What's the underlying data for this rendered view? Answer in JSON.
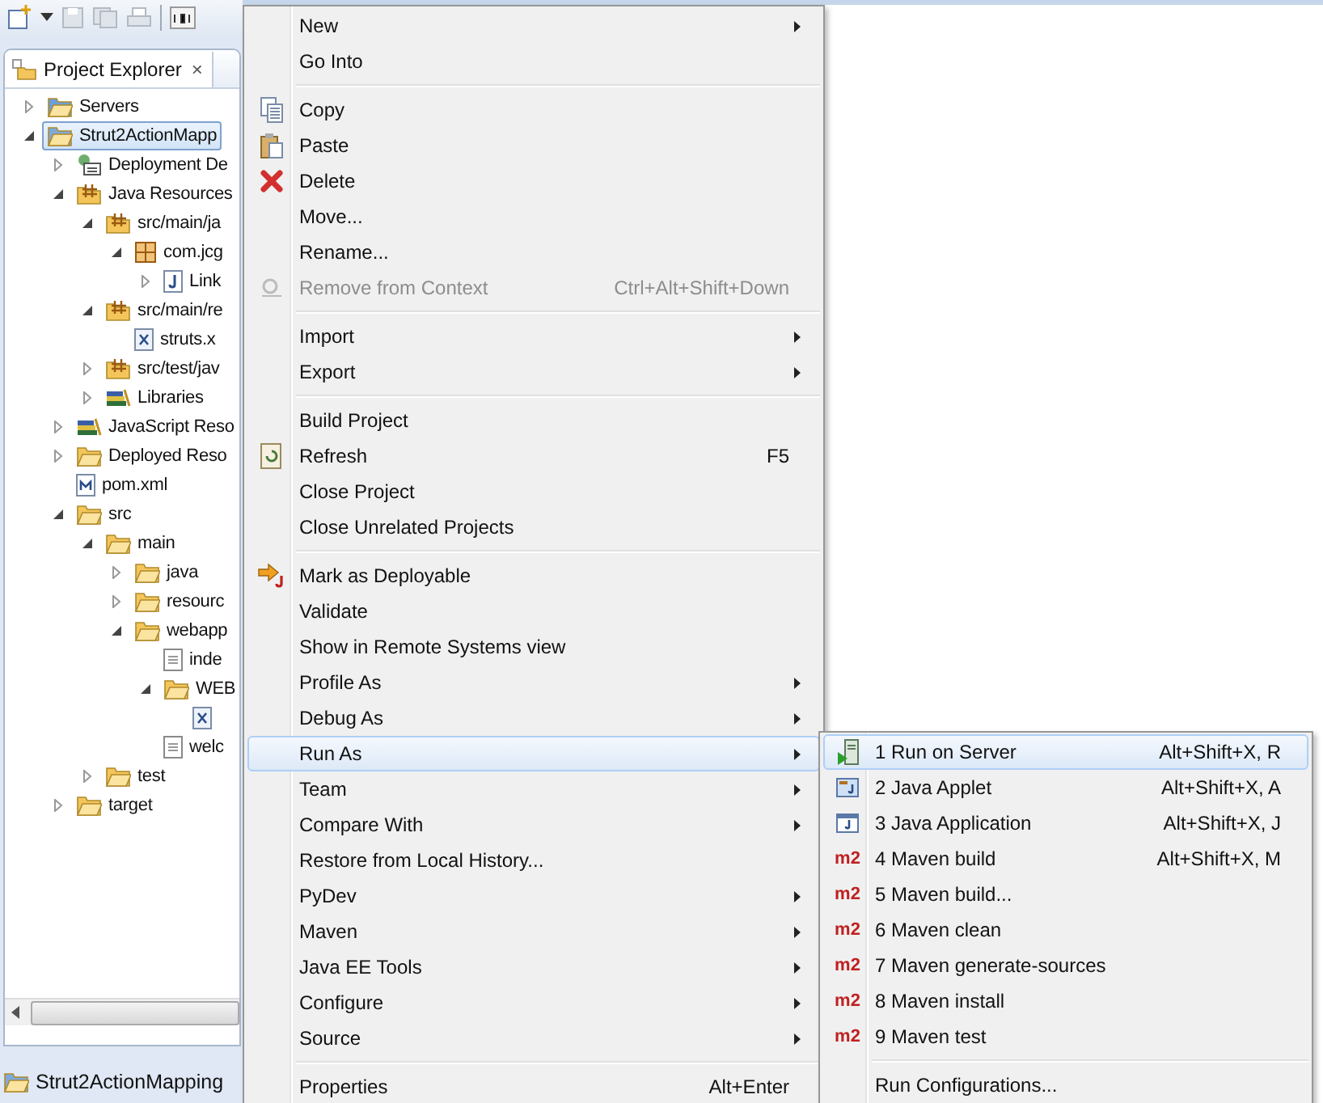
{
  "view": {
    "tab_label": "Project Explorer",
    "close_label": "×"
  },
  "tree": [
    {
      "label": "Servers",
      "kind": "servers",
      "selected": false,
      "expanded": false
    },
    {
      "label": "Strut2ActionMapp",
      "kind": "project",
      "selected": true,
      "expanded": true,
      "children": [
        {
          "label": "Deployment De",
          "kind": "descriptor",
          "selected": false,
          "expanded": false
        },
        {
          "label": "Java Resources",
          "kind": "javares",
          "selected": false,
          "expanded": true,
          "children": [
            {
              "label": "src/main/ja",
              "kind": "srcfolder",
              "selected": false,
              "expanded": true,
              "children": [
                {
                  "label": "com.jcg",
                  "kind": "package",
                  "selected": false,
                  "expanded": true,
                  "children": [
                    {
                      "label": "Link",
                      "kind": "javafile",
                      "selected": false,
                      "expanded": false
                    }
                  ]
                }
              ]
            },
            {
              "label": "src/main/re",
              "kind": "srcfolder",
              "selected": false,
              "expanded": true,
              "children": [
                {
                  "label": "struts.x",
                  "kind": "xmlfile",
                  "selected": false
                }
              ]
            },
            {
              "label": "src/test/jav",
              "kind": "srcfolder",
              "selected": false,
              "expanded": false
            },
            {
              "label": "Libraries",
              "kind": "libraries",
              "selected": false,
              "expanded": false
            }
          ]
        },
        {
          "label": "JavaScript Reso",
          "kind": "jsres",
          "selected": false,
          "expanded": false
        },
        {
          "label": "Deployed Reso",
          "kind": "deployed",
          "selected": false,
          "expanded": false
        },
        {
          "label": "pom.xml",
          "kind": "pom",
          "selected": false
        },
        {
          "label": "src",
          "kind": "folder",
          "selected": false,
          "expanded": true,
          "children": [
            {
              "label": "main",
              "kind": "folder",
              "selected": false,
              "expanded": true,
              "children": [
                {
                  "label": "java",
                  "kind": "folder",
                  "selected": false,
                  "expanded": false
                },
                {
                  "label": "resourc",
                  "kind": "folder",
                  "selected": false,
                  "expanded": false
                },
                {
                  "label": "webapp",
                  "kind": "folder",
                  "selected": false,
                  "expanded": true,
                  "children": [
                    {
                      "label": "inde",
                      "kind": "file",
                      "selected": false
                    },
                    {
                      "label": "WEB",
                      "kind": "folder",
                      "selected": false,
                      "expanded": true,
                      "children": [
                        {
                          "kind": "xmlfile",
                          "selected": false
                        }
                      ]
                    },
                    {
                      "label": "welc",
                      "kind": "file",
                      "selected": false
                    }
                  ]
                }
              ]
            },
            {
              "label": "test",
              "kind": "folder",
              "selected": false,
              "expanded": false
            }
          ]
        },
        {
          "label": "target",
          "kind": "folder",
          "selected": false,
          "expanded": false
        }
      ]
    }
  ],
  "status_bar": {
    "label": "Strut2ActionMapping"
  },
  "context_menu": {
    "groups": [
      [
        {
          "label": "New",
          "kind": "plain",
          "has_submenu": true,
          "disabled": false,
          "selected": false
        },
        {
          "label": "Go Into",
          "kind": "plain",
          "has_submenu": false,
          "disabled": false,
          "selected": false
        }
      ],
      [
        {
          "label": "Copy",
          "kind": "copy",
          "has_submenu": false,
          "disabled": false,
          "selected": false
        },
        {
          "label": "Paste",
          "kind": "paste",
          "has_submenu": false,
          "disabled": false,
          "selected": false
        },
        {
          "label": "Delete",
          "kind": "delete",
          "has_submenu": false,
          "disabled": false,
          "selected": false
        },
        {
          "label": "Move...",
          "kind": "plain",
          "has_submenu": false,
          "disabled": false,
          "selected": false
        },
        {
          "label": "Rename...",
          "kind": "plain",
          "has_submenu": false,
          "disabled": false,
          "selected": false
        },
        {
          "label": "Remove from Context",
          "kind": "context",
          "shortcut": "Ctrl+Alt+Shift+Down",
          "has_submenu": false,
          "disabled": true,
          "selected": false
        }
      ],
      [
        {
          "label": "Import",
          "kind": "plain",
          "has_submenu": true,
          "disabled": false,
          "selected": false
        },
        {
          "label": "Export",
          "kind": "plain",
          "has_submenu": true,
          "disabled": false,
          "selected": false
        }
      ],
      [
        {
          "label": "Build Project",
          "kind": "plain",
          "has_submenu": false,
          "disabled": false,
          "selected": false
        },
        {
          "label": "Refresh",
          "kind": "refresh",
          "shortcut": "F5",
          "has_submenu": false,
          "disabled": false,
          "selected": false
        },
        {
          "label": "Close Project",
          "kind": "plain",
          "has_submenu": false,
          "disabled": false,
          "selected": false
        },
        {
          "label": "Close Unrelated Projects",
          "kind": "plain",
          "has_submenu": false,
          "disabled": false,
          "selected": false
        }
      ],
      [
        {
          "label": "Mark as Deployable",
          "kind": "deploy",
          "has_submenu": false,
          "disabled": false,
          "selected": false
        },
        {
          "label": "Validate",
          "kind": "plain",
          "has_submenu": false,
          "disabled": false,
          "selected": false
        },
        {
          "label": "Show in Remote Systems view",
          "kind": "plain",
          "has_submenu": false,
          "disabled": false,
          "selected": false
        },
        {
          "label": "Profile As",
          "kind": "plain",
          "has_submenu": true,
          "disabled": false,
          "selected": false
        },
        {
          "label": "Debug As",
          "kind": "plain",
          "has_submenu": true,
          "disabled": false,
          "selected": false
        },
        {
          "label": "Run As",
          "kind": "plain",
          "has_submenu": true,
          "disabled": false,
          "selected": true
        },
        {
          "label": "Team",
          "kind": "plain",
          "has_submenu": true,
          "disabled": false,
          "selected": false
        },
        {
          "label": "Compare With",
          "kind": "plain",
          "has_submenu": true,
          "disabled": false,
          "selected": false
        },
        {
          "label": "Restore from Local History...",
          "kind": "plain",
          "has_submenu": false,
          "disabled": false,
          "selected": false
        },
        {
          "label": "PyDev",
          "kind": "plain",
          "has_submenu": true,
          "disabled": false,
          "selected": false
        },
        {
          "label": "Maven",
          "kind": "plain",
          "has_submenu": true,
          "disabled": false,
          "selected": false
        },
        {
          "label": "Java EE Tools",
          "kind": "plain",
          "has_submenu": true,
          "disabled": false,
          "selected": false
        },
        {
          "label": "Configure",
          "kind": "plain",
          "has_submenu": true,
          "disabled": false,
          "selected": false
        },
        {
          "label": "Source",
          "kind": "plain",
          "has_submenu": true,
          "disabled": false,
          "selected": false
        }
      ],
      [
        {
          "label": "Properties",
          "kind": "plain",
          "shortcut": "Alt+Enter",
          "has_submenu": false,
          "disabled": false,
          "selected": false
        }
      ]
    ]
  },
  "run_as_submenu": {
    "groups": [
      [
        {
          "label": "1 Run on Server",
          "kind": "server",
          "shortcut": "Alt+Shift+X, R",
          "selected": true
        },
        {
          "label": "2 Java Applet",
          "kind": "applet",
          "shortcut": "Alt+Shift+X, A",
          "selected": false
        },
        {
          "label": "3 Java Application",
          "kind": "application",
          "shortcut": "Alt+Shift+X, J",
          "selected": false
        },
        {
          "label": "4 Maven build",
          "kind": "maven",
          "badge": "m2",
          "shortcut": "Alt+Shift+X, M",
          "selected": false
        },
        {
          "label": "5 Maven build...",
          "kind": "maven",
          "badge": "m2",
          "selected": false
        },
        {
          "label": "6 Maven clean",
          "kind": "maven",
          "badge": "m2",
          "selected": false
        },
        {
          "label": "7 Maven generate-sources",
          "kind": "maven",
          "badge": "m2",
          "selected": false
        },
        {
          "label": "8 Maven install",
          "kind": "maven",
          "badge": "m2",
          "selected": false
        },
        {
          "label": "9 Maven test",
          "kind": "maven",
          "badge": "m2",
          "selected": false
        }
      ],
      [
        {
          "label": "Run Configurations...",
          "kind": "plain",
          "selected": false
        }
      ]
    ]
  }
}
